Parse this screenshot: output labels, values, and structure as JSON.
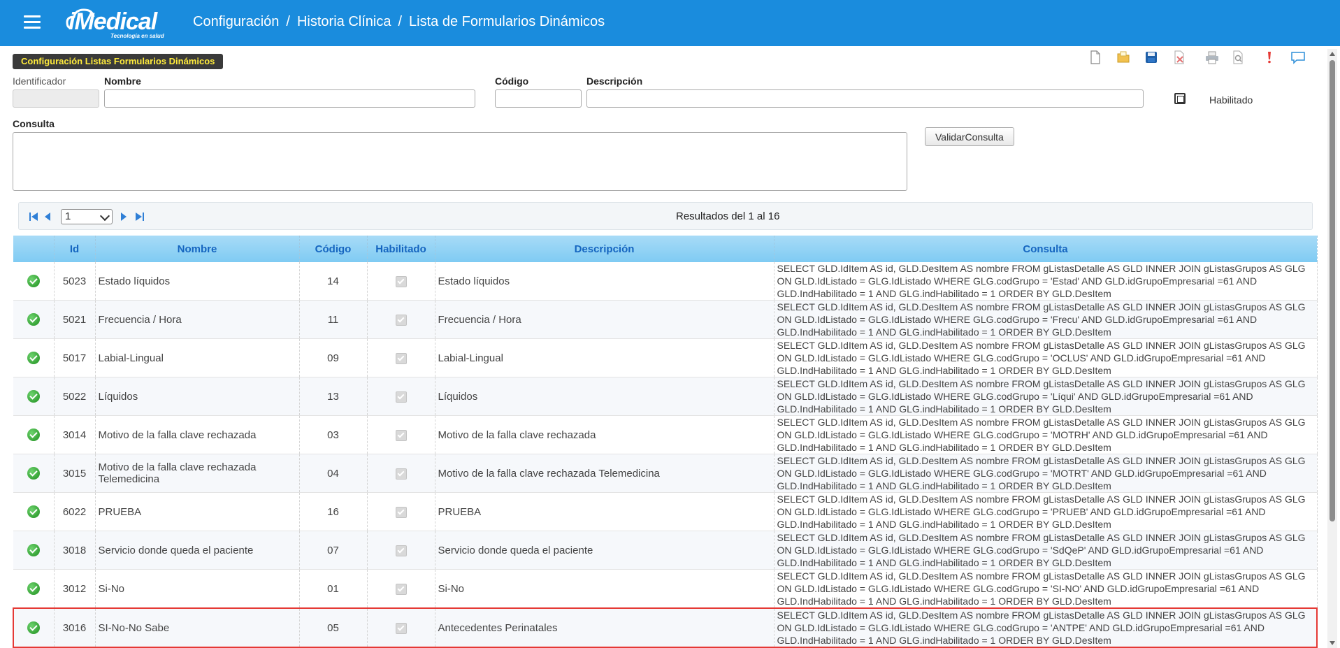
{
  "header": {
    "logo_text": "iMedical",
    "logo_tagline": "Tecnología en salud",
    "breadcrumb": [
      "Configuración",
      "Historia Clínica",
      "Lista de Formularios Dinámicos"
    ],
    "separator": "/"
  },
  "toolbar": {
    "icons": [
      "new-document-icon",
      "open-folder-icon",
      "save-icon",
      "delete-icon",
      "print-icon",
      "preview-icon",
      "alert-icon",
      "comment-icon"
    ]
  },
  "form": {
    "panel_title": "Configuración Listas Formularios Dinámicos",
    "identificador_label": "Identificador",
    "nombre_label": "Nombre",
    "codigo_label": "Código",
    "descripcion_label": "Descripción",
    "habilitado_label": "Habilitado",
    "consulta_label": "Consulta",
    "validate_button": "ValidarConsulta"
  },
  "pager": {
    "current_page": "1",
    "results_text": "Resultados del 1 al 16"
  },
  "table": {
    "columns": [
      "Id",
      "Nombre",
      "Código",
      "Habilitado",
      "Descripción",
      "Consulta"
    ],
    "rows": [
      {
        "id": "5023",
        "nombre": "Estado líquidos",
        "codigo": "14",
        "descripcion": "Estado líquidos",
        "consulta": "SELECT GLD.IdItem AS id, GLD.DesItem AS nombre FROM gListasDetalle AS GLD INNER JOIN gListasGrupos AS GLG ON GLD.IdListado = GLG.IdListado WHERE GLG.codGrupo = 'Estad' AND GLD.idGrupoEmpresarial =61 AND GLD.IndHabilitado = 1 AND GLG.indHabilitado = 1 ORDER BY GLD.DesItem"
      },
      {
        "id": "5021",
        "nombre": "Frecuencia / Hora",
        "codigo": "11",
        "descripcion": "Frecuencia / Hora",
        "consulta": "SELECT GLD.IdItem AS id, GLD.DesItem AS nombre FROM gListasDetalle AS GLD INNER JOIN gListasGrupos AS GLG ON GLD.IdListado = GLG.IdListado WHERE GLG.codGrupo = 'Frecu' AND GLD.idGrupoEmpresarial =61 AND GLD.IndHabilitado = 1 AND GLG.indHabilitado = 1 ORDER BY GLD.DesItem"
      },
      {
        "id": "5017",
        "nombre": "Labial-Lingual",
        "codigo": "09",
        "descripcion": "Labial-Lingual",
        "consulta": "SELECT GLD.IdItem AS id, GLD.DesItem AS nombre FROM gListasDetalle AS GLD INNER JOIN gListasGrupos AS GLG ON GLD.IdListado = GLG.IdListado WHERE GLG.codGrupo = 'OCLUS' AND GLD.idGrupoEmpresarial =61 AND GLD.IndHabilitado = 1 AND GLG.indHabilitado = 1 ORDER BY GLD.DesItem"
      },
      {
        "id": "5022",
        "nombre": "Líquidos",
        "codigo": "13",
        "descripcion": "Líquidos",
        "consulta": "SELECT GLD.IdItem AS id, GLD.DesItem AS nombre FROM gListasDetalle AS GLD INNER JOIN gListasGrupos AS GLG ON GLD.IdListado = GLG.IdListado WHERE GLG.codGrupo = 'Líqui' AND GLD.idGrupoEmpresarial =61 AND GLD.IndHabilitado = 1 AND GLG.indHabilitado = 1 ORDER BY GLD.DesItem"
      },
      {
        "id": "3014",
        "nombre": "Motivo de la falla clave rechazada",
        "codigo": "03",
        "descripcion": "Motivo de la falla clave rechazada",
        "consulta": "SELECT GLD.IdItem AS id, GLD.DesItem AS nombre FROM gListasDetalle AS GLD INNER JOIN gListasGrupos AS GLG ON GLD.IdListado = GLG.IdListado WHERE GLG.codGrupo = 'MOTRH' AND GLD.idGrupoEmpresarial =61 AND GLD.IndHabilitado = 1 AND GLG.indHabilitado = 1 ORDER BY GLD.DesItem"
      },
      {
        "id": "3015",
        "nombre": "Motivo de la falla clave rechazada Telemedicina",
        "codigo": "04",
        "descripcion": "Motivo de la falla clave rechazada Telemedicina",
        "consulta": "SELECT GLD.IdItem AS id, GLD.DesItem AS nombre FROM gListasDetalle AS GLD INNER JOIN gListasGrupos AS GLG ON GLD.IdListado = GLG.IdListado WHERE GLG.codGrupo = 'MOTRT' AND GLD.idGrupoEmpresarial =61 AND GLD.IndHabilitado = 1 AND GLG.indHabilitado = 1 ORDER BY GLD.DesItem"
      },
      {
        "id": "6022",
        "nombre": "PRUEBA",
        "codigo": "16",
        "descripcion": "PRUEBA",
        "consulta": "SELECT GLD.IdItem AS id, GLD.DesItem AS nombre FROM gListasDetalle AS GLD INNER JOIN gListasGrupos AS GLG ON GLD.IdListado = GLG.IdListado WHERE GLG.codGrupo = 'PRUEB' AND GLD.idGrupoEmpresarial =61 AND GLD.IndHabilitado = 1 AND GLG.indHabilitado = 1 ORDER BY GLD.DesItem"
      },
      {
        "id": "3018",
        "nombre": "Servicio donde queda el paciente",
        "codigo": "07",
        "descripcion": "Servicio donde queda el paciente",
        "consulta": "SELECT GLD.IdItem AS id, GLD.DesItem AS nombre FROM gListasDetalle AS GLD INNER JOIN gListasGrupos AS GLG ON GLD.IdListado = GLG.IdListado WHERE GLG.codGrupo = 'SdQeP' AND GLD.idGrupoEmpresarial =61 AND GLD.IndHabilitado = 1 AND GLG.indHabilitado = 1 ORDER BY GLD.DesItem"
      },
      {
        "id": "3012",
        "nombre": "Si-No",
        "codigo": "01",
        "descripcion": "Si-No",
        "consulta": "SELECT GLD.IdItem AS id, GLD.DesItem AS nombre FROM gListasDetalle AS GLD INNER JOIN gListasGrupos AS GLG ON GLD.IdListado = GLG.IdListado WHERE GLG.codGrupo = 'SI-NO' AND GLD.idGrupoEmpresarial =61 AND GLD.IndHabilitado = 1 AND GLG.indHabilitado = 1 ORDER BY GLD.DesItem"
      },
      {
        "id": "3016",
        "nombre": "SI-No-No Sabe",
        "codigo": "05",
        "descripcion": "Antecedentes Perinatales",
        "consulta": "SELECT GLD.IdItem AS id, GLD.DesItem AS nombre FROM gListasDetalle AS GLD INNER JOIN gListasGrupos AS GLG ON GLD.IdListado = GLG.IdListado WHERE GLG.codGrupo = 'ANTPE' AND GLD.idGrupoEmpresarial =61 AND GLD.IndHabilitado = 1 AND GLG.indHabilitado = 1 ORDER BY GLD.DesItem"
      }
    ]
  }
}
